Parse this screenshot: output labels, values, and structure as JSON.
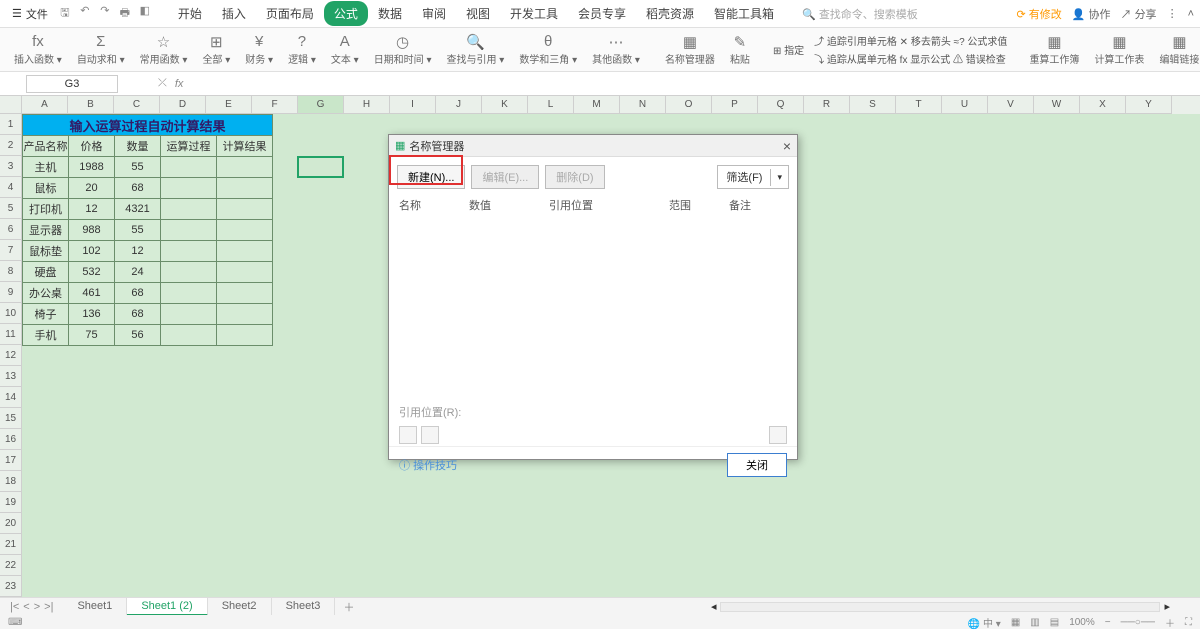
{
  "menu": {
    "file": "文件",
    "tabs": [
      "开始",
      "插入",
      "页面布局",
      "公式",
      "数据",
      "审阅",
      "视图",
      "开发工具",
      "会员专享",
      "稻壳资源",
      "智能工具箱"
    ],
    "active_tab": 3,
    "search_placeholder": "查找命令、搜索模板",
    "right": {
      "pending": "有修改",
      "collab": "协作",
      "share": "分享"
    }
  },
  "ribbon": {
    "items": [
      {
        "ico": "fx",
        "lbl": "插入函数"
      },
      {
        "ico": "Σ",
        "lbl": "自动求和"
      },
      {
        "ico": "☆",
        "lbl": "常用函数"
      },
      {
        "ico": "⊞",
        "lbl": "全部"
      },
      {
        "ico": "¥",
        "lbl": "财务"
      },
      {
        "ico": "?",
        "lbl": "逻辑"
      },
      {
        "ico": "A",
        "lbl": "文本"
      },
      {
        "ico": "◷",
        "lbl": "日期和时间"
      },
      {
        "ico": "🔍",
        "lbl": "查找与引用"
      },
      {
        "ico": "θ",
        "lbl": "数学和三角"
      },
      {
        "ico": "⋯",
        "lbl": "其他函数"
      },
      {
        "ico": "▦",
        "lbl": "名称管理器"
      },
      {
        "ico": "✎",
        "lbl": "粘贴"
      }
    ],
    "mini": [
      "⊞ 指定",
      "⤴ 追踪引用单元格   ✕ 移去箭头   ≈? 公式求值",
      "⤵ 追踪从属单元格   fx 显示公式   ⚠ 错误检查",
      "重算工作簿",
      "计算工作表",
      "编辑链接"
    ]
  },
  "namebox": "G3",
  "columns": [
    "A",
    "B",
    "C",
    "D",
    "E",
    "F",
    "G",
    "H",
    "I",
    "J",
    "K",
    "L",
    "M",
    "N",
    "O",
    "P",
    "Q",
    "R",
    "S",
    "T",
    "U",
    "V",
    "W",
    "X",
    "Y"
  ],
  "selected_col": "G",
  "row_count": 24,
  "table": {
    "title": "输入运算过程自动计算结果",
    "headers": [
      "产品名称",
      "价格",
      "数量",
      "运算过程",
      "计算结果"
    ],
    "rows": [
      [
        "主机",
        "1988",
        "55",
        "",
        ""
      ],
      [
        "鼠标",
        "20",
        "68",
        "",
        ""
      ],
      [
        "打印机",
        "12",
        "4321",
        "",
        ""
      ],
      [
        "显示器",
        "988",
        "55",
        "",
        ""
      ],
      [
        "鼠标垫",
        "102",
        "12",
        "",
        ""
      ],
      [
        "硬盘",
        "532",
        "24",
        "",
        ""
      ],
      [
        "办公桌",
        "461",
        "68",
        "",
        ""
      ],
      [
        "椅子",
        "136",
        "68",
        "",
        ""
      ],
      [
        "手机",
        "75",
        "56",
        "",
        ""
      ]
    ]
  },
  "dialog": {
    "title": "名称管理器",
    "new_btn": "新建(N)...",
    "edit_btn": "编辑(E)...",
    "delete_btn": "删除(D)",
    "filter": "筛选(F)",
    "cols": [
      "名称",
      "数值",
      "引用位置",
      "范围",
      "备注"
    ],
    "ref_label": "引用位置(R):",
    "tips": "操作技巧",
    "close": "关闭"
  },
  "sheets": {
    "tabs": [
      "Sheet1",
      "Sheet1 (2)",
      "Sheet2",
      "Sheet3"
    ],
    "active": 1
  },
  "status": {
    "zoom": "100%",
    "ime": "中"
  }
}
